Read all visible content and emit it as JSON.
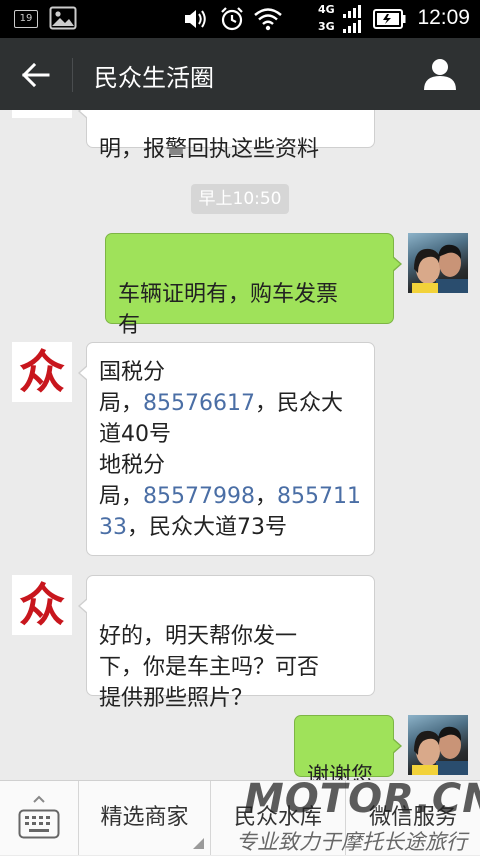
{
  "status_bar": {
    "badge": "19",
    "network_top": "4G",
    "network_bottom": "3G",
    "time": "12:09"
  },
  "header": {
    "title": "民众生活圈",
    "back_icon": "arrow-left-icon",
    "profile_icon": "person-icon"
  },
  "chat": {
    "timestamp": "早上10:50",
    "messages": [
      {
        "side": "in",
        "text": "明，报警回执这些资料"
      },
      {
        "side": "out",
        "text": "车辆证明有，购车发票\n有"
      },
      {
        "side": "in",
        "lines": [
          "国税分",
          "局，",
          "85576617",
          "，民众大",
          "道40号",
          "地税分",
          "局，",
          "85577998",
          "，",
          "855711",
          "33",
          "，民众大道73号"
        ]
      },
      {
        "side": "in",
        "text": "好的，明天帮你发一\n下，你是车主吗？可否\n提供那些照片？"
      },
      {
        "side": "out",
        "text": "谢谢您"
      }
    ],
    "brand_avatar_char": "众"
  },
  "bottom_menu": {
    "keyboard_icon": "keyboard-icon",
    "items": [
      "精选商家",
      "民众水库",
      "微信服务"
    ]
  },
  "watermark": {
    "big": "MOTOR.CN",
    "small": "专业致力于摩托长途旅行"
  },
  "colors": {
    "titlebar": "#2e3132",
    "out_bubble": "#9fe25a",
    "phone_link": "#4a6ea5",
    "brand_red": "#c8161d"
  }
}
